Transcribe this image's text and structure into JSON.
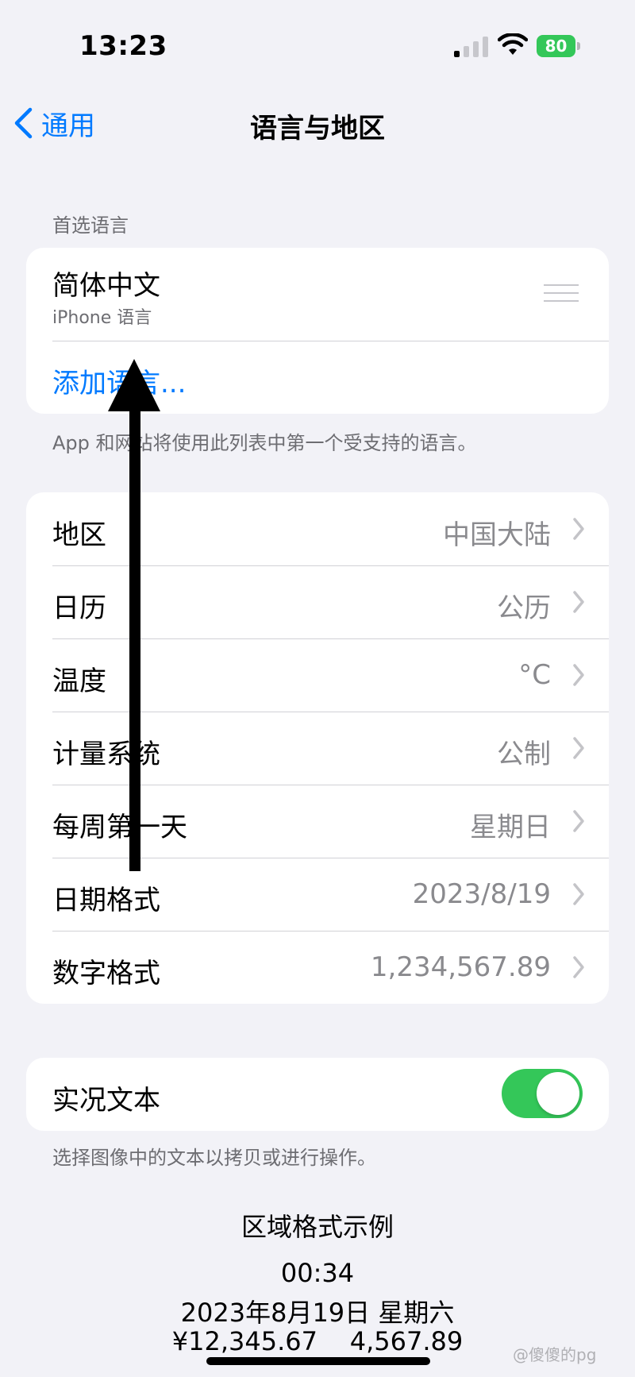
{
  "status_bar": {
    "time": "13:23",
    "battery": "80"
  },
  "nav": {
    "back_label": "通用",
    "title": "语言与地区"
  },
  "preferred": {
    "header": "首选语言",
    "language": "简体中文",
    "language_sub": "iPhone 语言",
    "add_label": "添加语言...",
    "footer": "App 和网站将使用此列表中第一个受支持的语言。"
  },
  "settings": [
    {
      "label": "地区",
      "value": "中国大陆"
    },
    {
      "label": "日历",
      "value": "公历"
    },
    {
      "label": "温度",
      "value": "°C"
    },
    {
      "label": "计量系统",
      "value": "公制"
    },
    {
      "label": "每周第一天",
      "value": "星期日"
    },
    {
      "label": "日期格式",
      "value": "2023/8/19"
    },
    {
      "label": "数字格式",
      "value": "1,234,567.89"
    }
  ],
  "live_text": {
    "label": "实况文本",
    "enabled": true,
    "footer": "选择图像中的文本以拷贝或进行操作。"
  },
  "example": {
    "title": "区域格式示例",
    "time": "00:34",
    "date": "2023年8月19日 星期六",
    "numbers": "¥12,345.67    4,567.89"
  },
  "watermark": "@傻傻的pg",
  "colors": {
    "accent": "#007aff",
    "toggle_on": "#34c759",
    "background": "#f2f2f7"
  }
}
